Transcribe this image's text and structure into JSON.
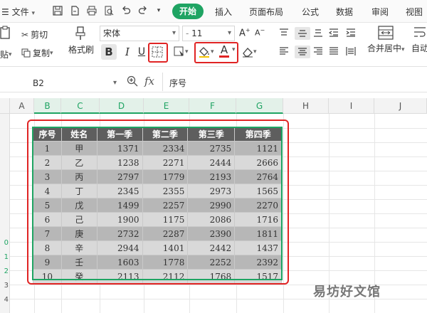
{
  "menubar": {
    "file_menu": "文件",
    "tabs": [
      "开始",
      "插入",
      "页面布局",
      "公式",
      "数据",
      "审阅",
      "视图"
    ],
    "active_tab": "开始",
    "accent_color": "#1fa463"
  },
  "ribbon": {
    "cut_label": "剪切",
    "copy_label": "复制",
    "format_painter_label": "格式刷",
    "paste_label": "贴",
    "font_name": "宋体",
    "font_size": "11",
    "bold": "B",
    "italic": "I",
    "underline": "U",
    "font_color_letter": "A",
    "merge_center_label": "合并居中",
    "auto_wrap_label": "自动"
  },
  "formula_bar": {
    "cell_ref": "B2",
    "fx_label": "fx",
    "content": "序号"
  },
  "grid": {
    "columns": [
      "A",
      "B",
      "C",
      "D",
      "E",
      "F",
      "G",
      "H",
      "I",
      "J"
    ],
    "selected_columns": [
      "B",
      "C",
      "D",
      "E",
      "F",
      "G"
    ],
    "row_numbers_visible": [
      "0",
      "1",
      "2",
      "3",
      "4"
    ]
  },
  "table": {
    "headers": [
      "序号",
      "姓名",
      "第一季",
      "第二季",
      "第三季",
      "第四季"
    ],
    "rows": [
      [
        "1",
        "甲",
        "1371",
        "2334",
        "2735",
        "1121"
      ],
      [
        "2",
        "乙",
        "1238",
        "2271",
        "2444",
        "2666"
      ],
      [
        "3",
        "丙",
        "2797",
        "1779",
        "2193",
        "2764"
      ],
      [
        "4",
        "丁",
        "2345",
        "2355",
        "2973",
        "1565"
      ],
      [
        "5",
        "戊",
        "1499",
        "2257",
        "2990",
        "2270"
      ],
      [
        "6",
        "己",
        "1900",
        "1175",
        "2086",
        "1716"
      ],
      [
        "7",
        "庚",
        "2732",
        "2287",
        "2390",
        "1811"
      ],
      [
        "8",
        "辛",
        "2944",
        "1401",
        "2442",
        "1437"
      ],
      [
        "9",
        "壬",
        "1603",
        "1778",
        "2252",
        "2392"
      ],
      [
        "10",
        "癸",
        "2113",
        "2112",
        "1768",
        "1517"
      ]
    ]
  },
  "watermark": "易坊好文馆",
  "highlight_color": "#e02424"
}
